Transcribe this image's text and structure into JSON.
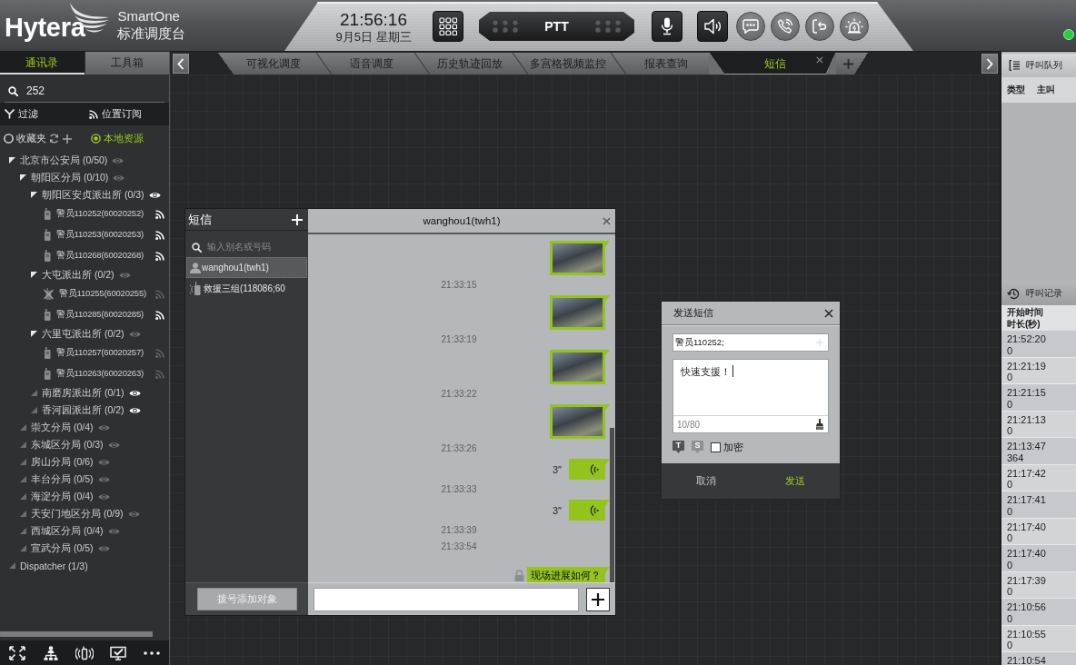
{
  "header": {
    "brand": "Hytera",
    "product": "SmartOne",
    "product_subtitle": "标准调度台",
    "time": "21:56:16",
    "date": "9月5日 星期三",
    "ptt_label": "PTT",
    "online": true
  },
  "sidebar": {
    "tabs": [
      {
        "label": "通讯录",
        "selected": true
      },
      {
        "label": "工具箱",
        "selected": false
      }
    ],
    "search": {
      "value": "252"
    },
    "filter_label": "过滤",
    "subscribe_label": "位置订阅",
    "sources": [
      {
        "label": "收藏夹",
        "selected": false
      },
      {
        "label": "本地资源",
        "selected": true
      }
    ],
    "tree": [
      {
        "kind": "group",
        "label": "北京市公安局 (0/50)",
        "expanded": true,
        "monitored": false,
        "children": [
          {
            "kind": "group",
            "label": "朝阳区分局 (0/10)",
            "expanded": true,
            "monitored": false,
            "children": [
              {
                "kind": "group",
                "label": "朝阳区安贞派出所 (0/3)",
                "expanded": true,
                "monitored": true,
                "children": [
                  {
                    "kind": "device",
                    "label": "警员110252(60020252)",
                    "online": true,
                    "subscribed": true
                  },
                  {
                    "kind": "device",
                    "label": "警员110253(60020253)",
                    "online": true,
                    "subscribed": true
                  },
                  {
                    "kind": "device",
                    "label": "警员110268(60020268)",
                    "online": true,
                    "subscribed": true
                  }
                ]
              },
              {
                "kind": "group",
                "label": "大屯派出所 (0/2)",
                "expanded": true,
                "monitored": false,
                "children": [
                  {
                    "kind": "device",
                    "label": "警员110255(60020255)",
                    "online": false,
                    "subscribed": false
                  },
                  {
                    "kind": "device",
                    "label": "警员110285(60020285)",
                    "online": true,
                    "subscribed": true
                  }
                ]
              },
              {
                "kind": "group",
                "label": "六里屯派出所 (0/2)",
                "expanded": true,
                "monitored": false,
                "children": [
                  {
                    "kind": "device",
                    "label": "警员110257(60020257)",
                    "online": true,
                    "subscribed": false
                  },
                  {
                    "kind": "device",
                    "label": "警员110263(60020263)",
                    "online": true,
                    "subscribed": false
                  }
                ]
              },
              {
                "kind": "group",
                "label": "南磨房派出所 (0/1)",
                "expanded": false,
                "monitored": true
              },
              {
                "kind": "group",
                "label": "香河园派出所 (0/2)",
                "expanded": false,
                "monitored": true
              }
            ]
          },
          {
            "kind": "group",
            "label": "崇文分局 (0/4)",
            "expanded": false,
            "monitored": false
          },
          {
            "kind": "group",
            "label": "东城区分局 (0/3)",
            "expanded": false,
            "monitored": false
          },
          {
            "kind": "group",
            "label": "房山分局 (0/6)",
            "expanded": false,
            "monitored": false
          },
          {
            "kind": "group",
            "label": "丰台分局 (0/5)",
            "expanded": false,
            "monitored": false
          },
          {
            "kind": "group",
            "label": "海淀分局 (0/4)",
            "expanded": false,
            "monitored": false
          },
          {
            "kind": "group",
            "label": "天安门地区分局 (0/9)",
            "expanded": false,
            "monitored": false
          },
          {
            "kind": "group",
            "label": "西城区分局 (0/4)",
            "expanded": false,
            "monitored": false
          },
          {
            "kind": "group",
            "label": "宣武分局 (0/5)",
            "expanded": false,
            "monitored": false
          }
        ]
      },
      {
        "kind": "group",
        "label": "Dispatcher (1/3)",
        "expanded": false
      }
    ]
  },
  "main_tabs": [
    {
      "label": "可视化调度",
      "selected": false
    },
    {
      "label": "语音调度",
      "selected": false
    },
    {
      "label": "历史轨迹回放",
      "selected": false
    },
    {
      "label": "多宫格视频监控",
      "selected": false
    },
    {
      "label": "报表查询",
      "selected": false
    },
    {
      "label": "短信",
      "selected": true
    }
  ],
  "sms_window": {
    "title": "短信",
    "search": {
      "placeholder": "输入别名或号码"
    },
    "contacts": [
      {
        "kind": "person",
        "name": "wanghou1(twh1)",
        "selected": true
      },
      {
        "kind": "group",
        "name": "救援三组(118086;60",
        "selected": false
      }
    ],
    "dial_button": "拨号添加对象",
    "conversation": {
      "title": "wanghou1(twh1)",
      "messages": [
        {
          "kind": "image"
        },
        {
          "kind": "time",
          "text": "21:33:15"
        },
        {
          "kind": "image"
        },
        {
          "kind": "time",
          "text": "21:33:19"
        },
        {
          "kind": "image"
        },
        {
          "kind": "time",
          "text": "21:33:22"
        },
        {
          "kind": "image"
        },
        {
          "kind": "time",
          "text": "21:33:26"
        },
        {
          "kind": "voice",
          "duration": "3″"
        },
        {
          "kind": "time",
          "text": "21:33:33"
        },
        {
          "kind": "voice",
          "duration": "3″"
        },
        {
          "kind": "time",
          "text": "21:33:39"
        },
        {
          "kind": "time",
          "text": "21:33:54"
        },
        {
          "kind": "text",
          "text": "现场进展如何？",
          "encrypted": true
        }
      ]
    }
  },
  "send_dialog": {
    "title": "发送短信",
    "recipients": "警员110252;",
    "message": "快速支援！",
    "counter": "10/80",
    "modes": [
      {
        "label": "T",
        "selected": true
      },
      {
        "label": "S",
        "selected": false
      }
    ],
    "encrypt": {
      "label": "加密",
      "checked": false
    },
    "buttons": [
      {
        "kind": "cancel",
        "label": "取消"
      },
      {
        "kind": "send",
        "label": "发送"
      }
    ]
  },
  "call_queue": {
    "title": "呼叫队列",
    "columns": [
      "类型",
      "主叫"
    ]
  },
  "call_log": {
    "title": "呼叫记录",
    "columns": [
      "开始时间",
      "时长(秒)"
    ],
    "rows": [
      {
        "start": "21:52:20",
        "duration": "0"
      },
      {
        "start": "21:21:19",
        "duration": "0"
      },
      {
        "start": "21:21:15",
        "duration": "0"
      },
      {
        "start": "21:21:13",
        "duration": "0"
      },
      {
        "start": "21:13:47",
        "duration": "364"
      },
      {
        "start": "21:17:42",
        "duration": "0"
      },
      {
        "start": "21:17:41",
        "duration": "0"
      },
      {
        "start": "21:17:40",
        "duration": "0"
      },
      {
        "start": "21:17:40",
        "duration": "0"
      },
      {
        "start": "21:17:39",
        "duration": "0"
      },
      {
        "start": "21:10:56",
        "duration": "0"
      },
      {
        "start": "21:10:55",
        "duration": "0"
      },
      {
        "start": "21:10:54"
      }
    ]
  }
}
